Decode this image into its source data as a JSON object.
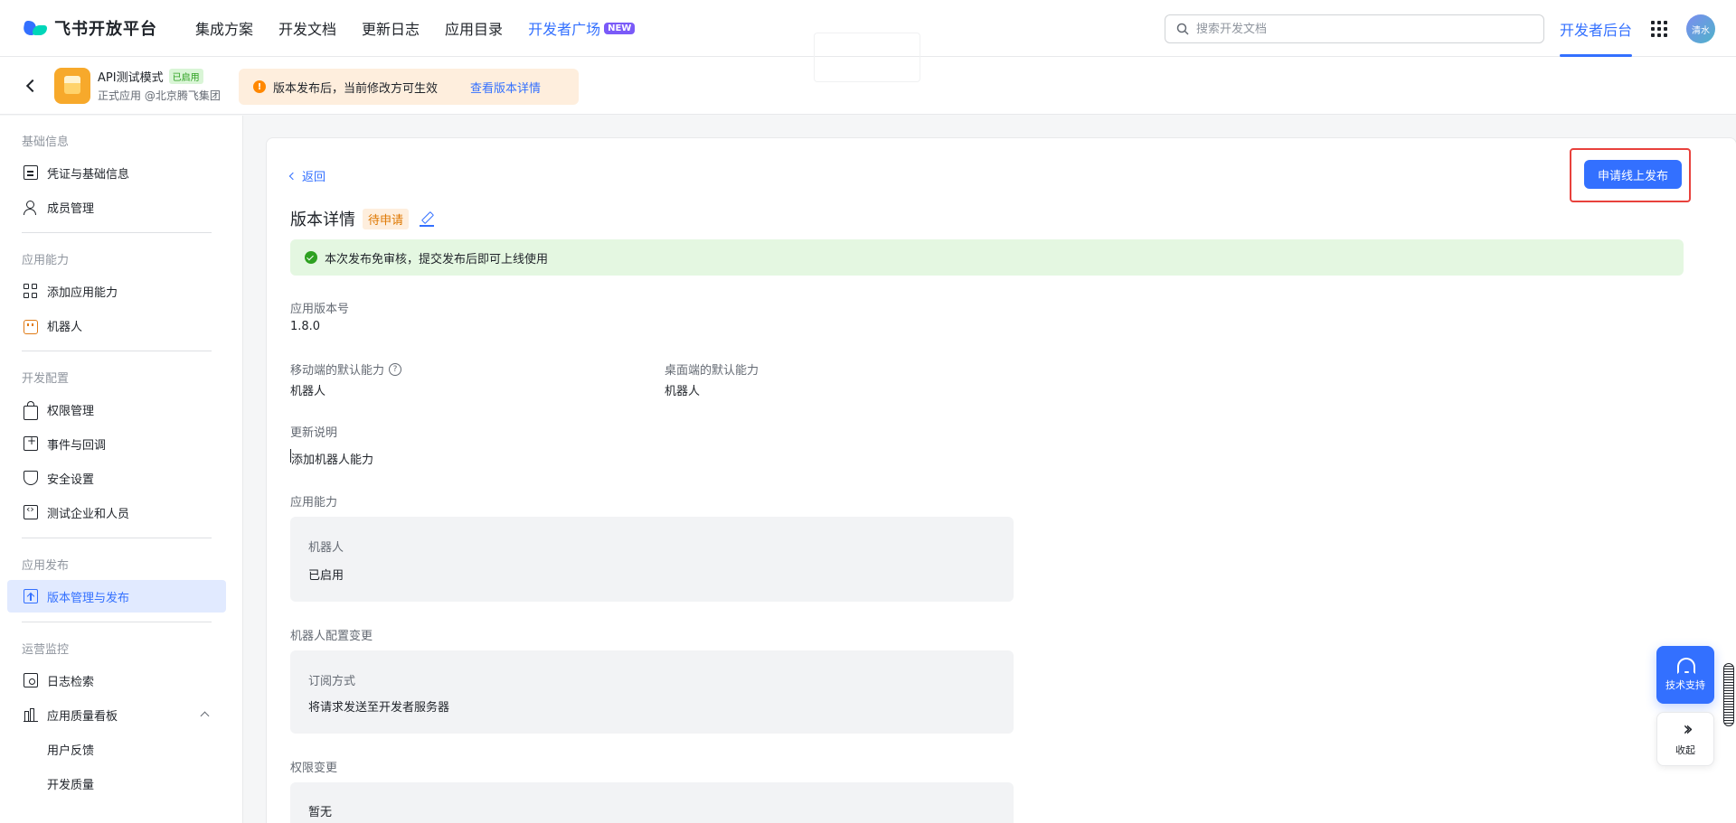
{
  "topnav": {
    "brand": "飞书开放平台",
    "links": [
      "集成方案",
      "开发文档",
      "更新日志",
      "应用目录"
    ],
    "dev_square": "开发者广场",
    "new_badge": "NEW",
    "search_placeholder": "搜索开发文档",
    "dev_backend": "开发者后台",
    "avatar_text": "清水"
  },
  "appbar": {
    "app_name": "API测试模式",
    "enabled_tag": "已启用",
    "app_org": "正式应用 @北京腾飞集团",
    "notice_text": "版本发布后，当前修改方可生效",
    "notice_link": "查看版本详情"
  },
  "sidebar": {
    "groups": [
      "基础信息",
      "应用能力",
      "开发配置",
      "应用发布",
      "运营监控"
    ],
    "items": [
      {
        "label": "凭证与基础信息",
        "icon": "credential-icon"
      },
      {
        "label": "成员管理",
        "icon": "user-add-icon"
      },
      {
        "label": "添加应用能力",
        "icon": "grid-add-icon"
      },
      {
        "label": "机器人",
        "icon": "robot-icon"
      },
      {
        "label": "权限管理",
        "icon": "lock-icon"
      },
      {
        "label": "事件与回调",
        "icon": "event-icon"
      },
      {
        "label": "安全设置",
        "icon": "shield-icon"
      },
      {
        "label": "测试企业和人员",
        "icon": "code-icon"
      },
      {
        "label": "版本管理与发布",
        "icon": "upload-icon",
        "active": true
      },
      {
        "label": "日志检索",
        "icon": "log-search-icon"
      },
      {
        "label": "应用质量看板",
        "icon": "bar-chart-icon"
      },
      {
        "label": "用户反馈"
      },
      {
        "label": "开发质量"
      }
    ]
  },
  "main": {
    "back": "返回",
    "publish_button": "申请线上发布",
    "title": "版本详情",
    "status": "待申请",
    "success_text": "本次发布免审核，提交发布后即可上线使用",
    "version_label": "应用版本号",
    "version_value": "1.8.0",
    "mobile_label": "移动端的默认能力",
    "mobile_value": "机器人",
    "desktop_label": "桌面端的默认能力",
    "desktop_value": "机器人",
    "notes_label": "更新说明",
    "notes_value": "添加机器人能力",
    "capability_label": "应用能力",
    "capability_box": {
      "title": "机器人",
      "value": "已启用"
    },
    "bot_config_label": "机器人配置变更",
    "bot_config_box": {
      "title": "订阅方式",
      "value": "将请求发送至开发者服务器"
    },
    "perm_label": "权限变更",
    "perm_box": {
      "value": "暂无"
    }
  },
  "float": {
    "support": "技术支持",
    "collapse": "收起"
  },
  "colors": {
    "accent": "#3370ff",
    "success": "#2ea121",
    "warning": "#ff8800",
    "highlight_frame": "#e8413c"
  }
}
